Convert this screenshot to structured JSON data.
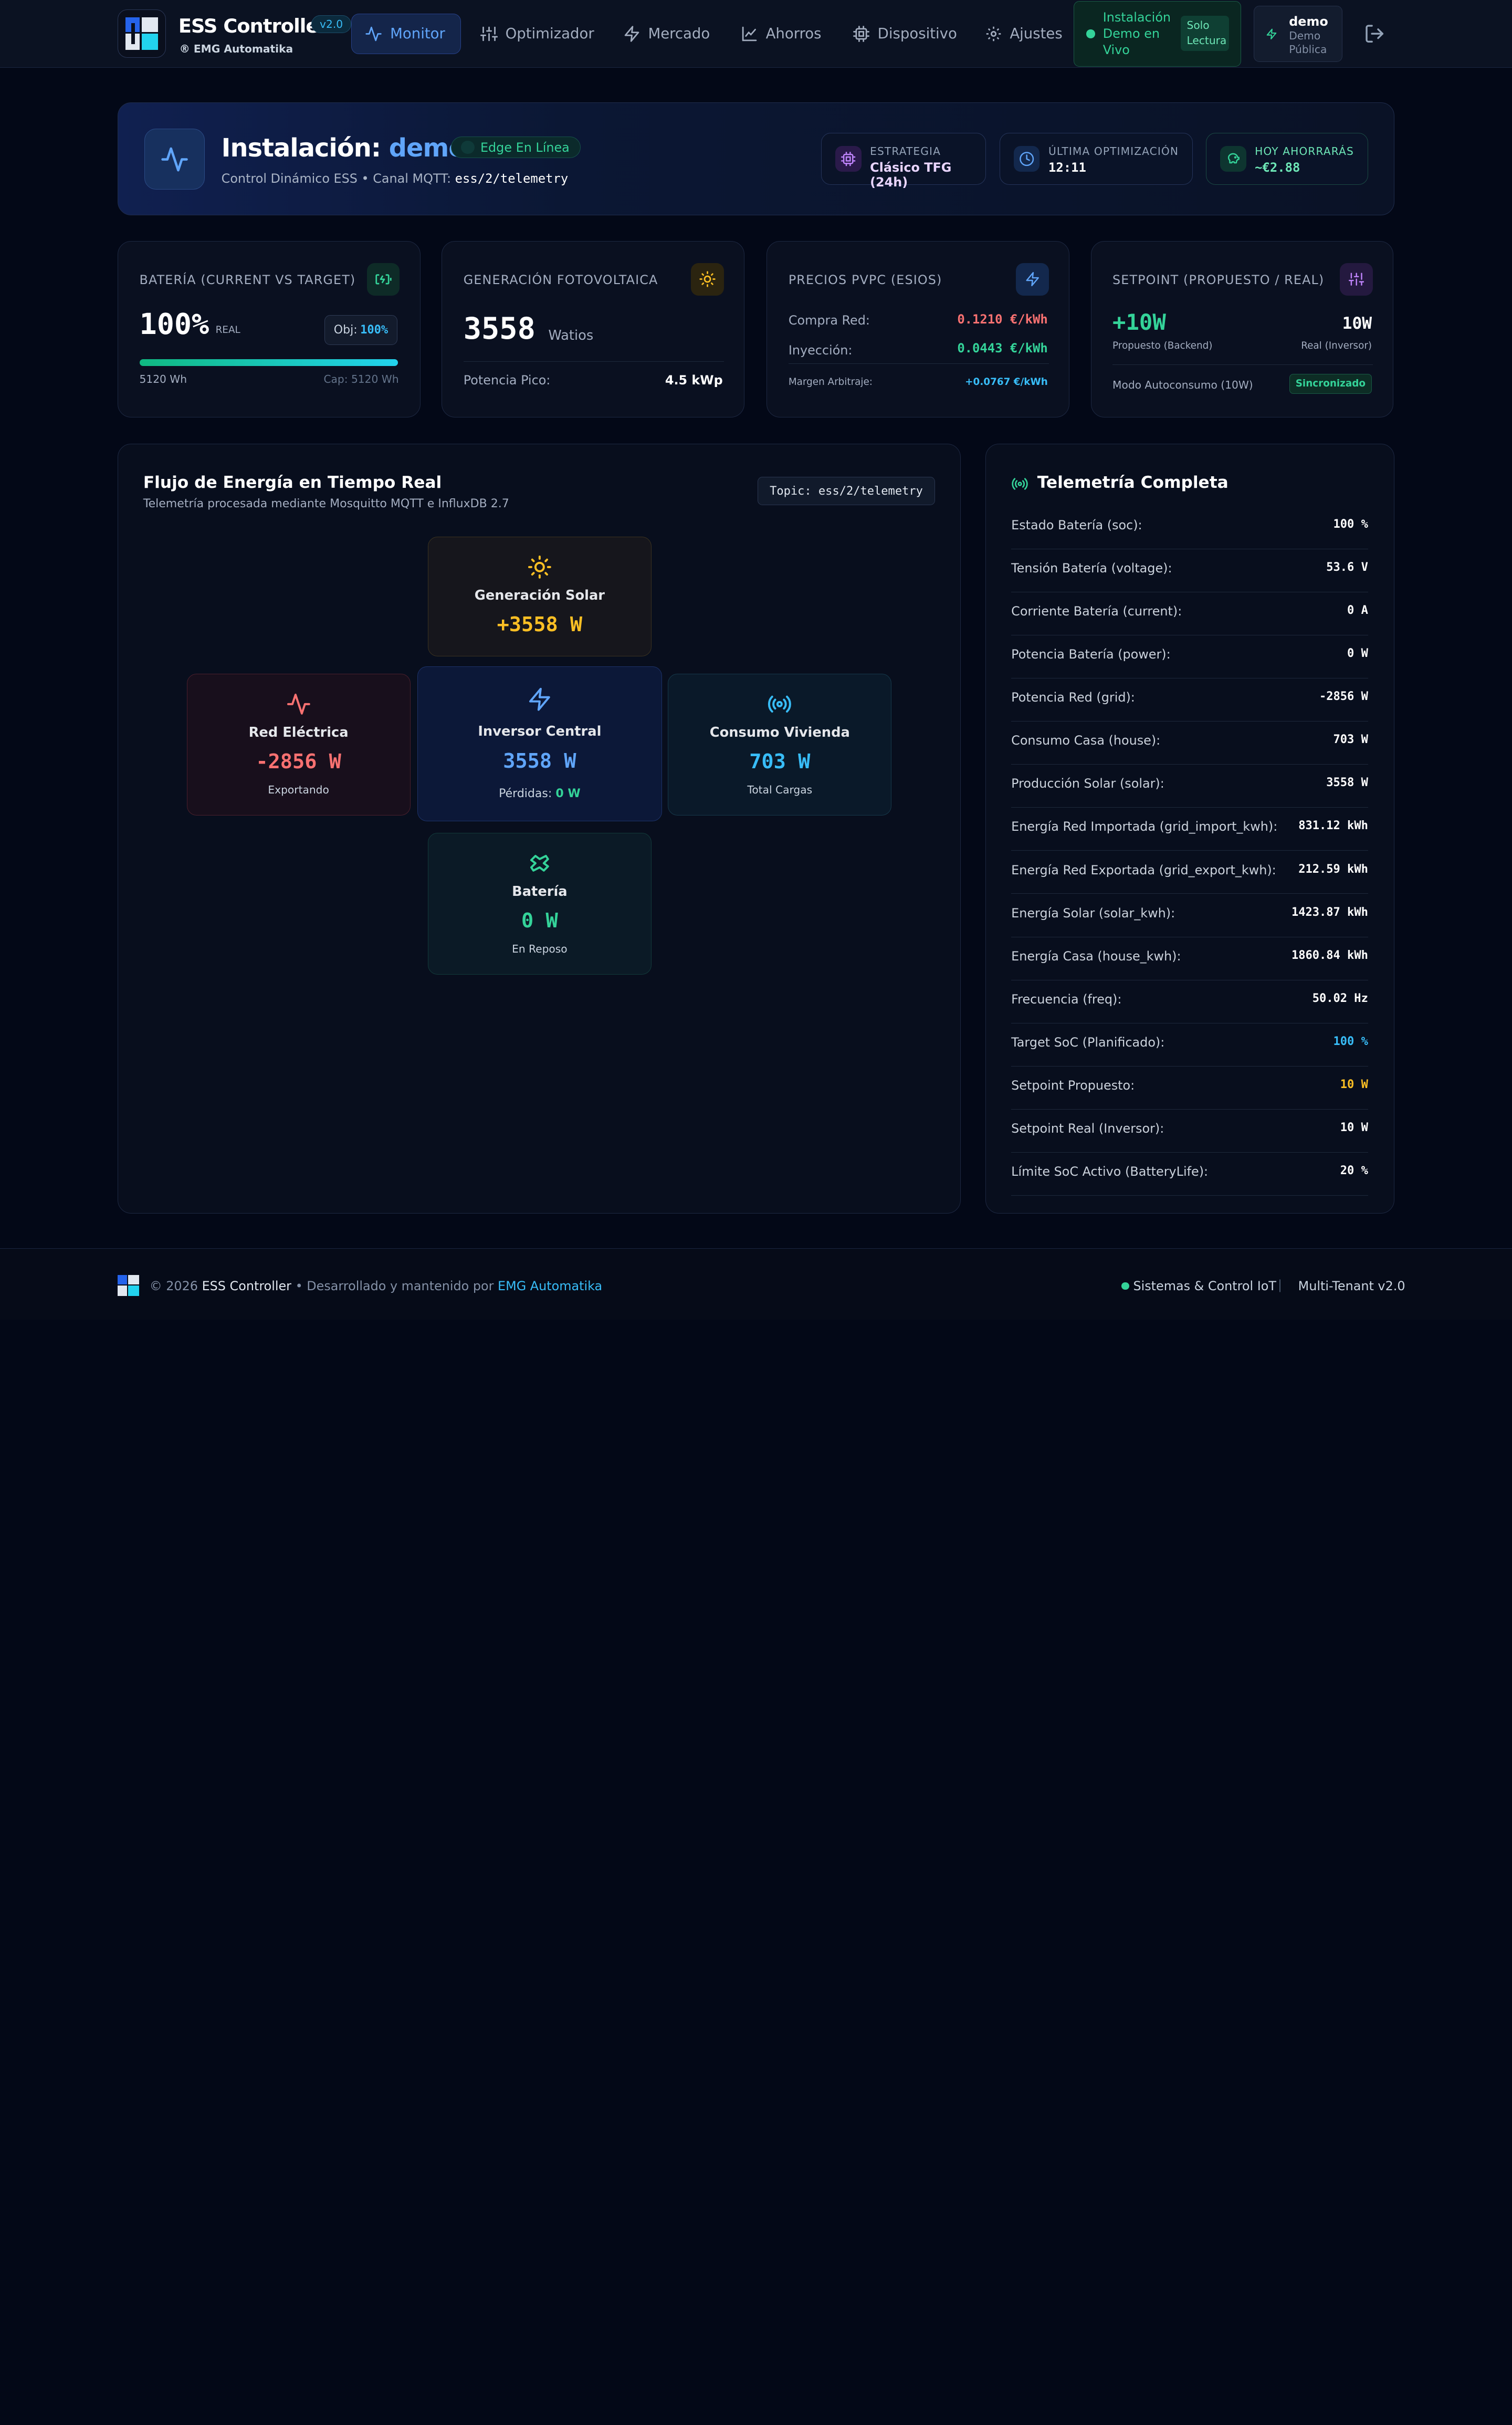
{
  "brand": {
    "title": "ESS Controller",
    "version": "v2.0",
    "subtitle": "® EMG Automatika"
  },
  "nav": [
    {
      "label": "Monitor",
      "icon": "activity-icon",
      "active": true
    },
    {
      "label": "Optimizador",
      "icon": "sliders-icon"
    },
    {
      "label": "Mercado",
      "icon": "zap-icon"
    },
    {
      "label": "Ahorros",
      "icon": "line-chart-icon"
    },
    {
      "label": "Dispositivo",
      "icon": "cpu-icon"
    },
    {
      "label": "Ajustes",
      "icon": "gear-icon"
    }
  ],
  "demo_pill": {
    "label": "Instalación Demo en Vivo",
    "badge": "Solo Lectura"
  },
  "user": {
    "name": "demo",
    "role": "Demo Pública"
  },
  "banner": {
    "title_prefix": "Instalación:",
    "title_name": "demo",
    "status": "Edge En Línea",
    "subtitle": "Control Dinámico ESS • Canal MQTT:",
    "channel": "ess/2/telemetry",
    "chips": [
      {
        "label": "ESTRATEGIA",
        "value": "Clásico TFG (24h)"
      },
      {
        "label": "ÚLTIMA OPTIMIZACIÓN",
        "value": "12:11"
      },
      {
        "label": "HOY AHORRARÁS",
        "value": "~€2.88"
      }
    ]
  },
  "cards": {
    "battery": {
      "title": "BATERÍA (CURRENT VS TARGET)",
      "value": "100%",
      "unit": "REAL",
      "target_label": "Obj:",
      "target": "100%",
      "level": 100,
      "energy": "5120 Wh",
      "capacity": "Cap: 5120 Wh"
    },
    "pv": {
      "title": "GENERACIÓN FOTOVOLTAICA",
      "value": "3558",
      "unit": "Watios",
      "peak_label": "Potencia Pico:",
      "peak": "4.5 kWp"
    },
    "prices": {
      "title": "PRECIOS PVPC (ESIOS)",
      "buy_label": "Compra Red:",
      "buy": "0.1210 €/kWh",
      "sell_label": "Inyección:",
      "sell": "0.0443 €/kWh",
      "margin_label": "Margen Arbitraje:",
      "margin": "+0.0767 €/kWh"
    },
    "setpoint": {
      "title": "SETPOINT (PROPUESTO / REAL)",
      "proposed": "+10W",
      "proposed_label": "Propuesto (Backend)",
      "real": "10W",
      "real_label": "Real (Inversor)",
      "mode": "Modo Autoconsumo (10W)",
      "status": "Sincronizado"
    }
  },
  "flow": {
    "title": "Flujo de Energía en Tiempo Real",
    "subtitle": "Telemetría procesada mediante Mosquitto MQTT e InfluxDB 2.7",
    "topic": "Topic: ess/2/telemetry",
    "solar": {
      "title": "Generación Solar",
      "value": "+3558 W"
    },
    "grid": {
      "title": "Red Eléctrica",
      "value": "-2856 W",
      "sub": "Exportando"
    },
    "inverter": {
      "title": "Inversor Central",
      "value": "3558 W",
      "loss_label": "Pérdidas:",
      "loss": "0 W"
    },
    "house": {
      "title": "Consumo Vivienda",
      "value": "703 W",
      "sub": "Total Cargas"
    },
    "battery": {
      "title": "Batería",
      "value": "0 W",
      "sub": "En Reposo"
    }
  },
  "telemetry": {
    "title": "Telemetría Completa",
    "rows": [
      {
        "key": "Estado Batería (soc):",
        "value": "100 %"
      },
      {
        "key": "Tensión Batería (voltage):",
        "value": "53.6 V"
      },
      {
        "key": "Corriente Batería (current):",
        "value": "0 A"
      },
      {
        "key": "Potencia Batería (power):",
        "value": "0 W"
      },
      {
        "key": "Potencia Red (grid):",
        "value": "-2856 W"
      },
      {
        "key": "Consumo Casa (house):",
        "value": "703 W"
      },
      {
        "key": "Producción Solar (solar):",
        "value": "3558 W"
      },
      {
        "key": "Energía Red Importada (grid_import_kwh):",
        "value": "831.12 kWh"
      },
      {
        "key": "Energía Red Exportada (grid_export_kwh):",
        "value": "212.59 kWh"
      },
      {
        "key": "Energía Solar (solar_kwh):",
        "value": "1423.87 kWh"
      },
      {
        "key": "Energía Casa (house_kwh):",
        "value": "1860.84 kWh"
      },
      {
        "key": "Frecuencia (freq):",
        "value": "50.02 Hz"
      },
      {
        "key": "Target SoC (Planificado):",
        "value": "100 %",
        "color": "#38bdf8"
      },
      {
        "key": "Setpoint Propuesto:",
        "value": "10 W",
        "color": "#fbbf24"
      },
      {
        "key": "Setpoint Real (Inversor):",
        "value": "10 W"
      },
      {
        "key": "Límite SoC Activo (BatteryLife):",
        "value": "20 %"
      }
    ]
  },
  "footer": {
    "copyright": "© 2026",
    "product": "ESS Controller",
    "dev_text": "• Desarrollado y mantenido por",
    "company": "EMG Automatika",
    "status": "Sistemas & Control IoT",
    "version": "Multi-Tenant v2.0"
  },
  "colors": {
    "accent": "#60a5fa",
    "green": "#34d399",
    "red": "#f87171",
    "yellow": "#fbbf24",
    "cyan": "#38bdf8",
    "purple": "#c084fc"
  }
}
